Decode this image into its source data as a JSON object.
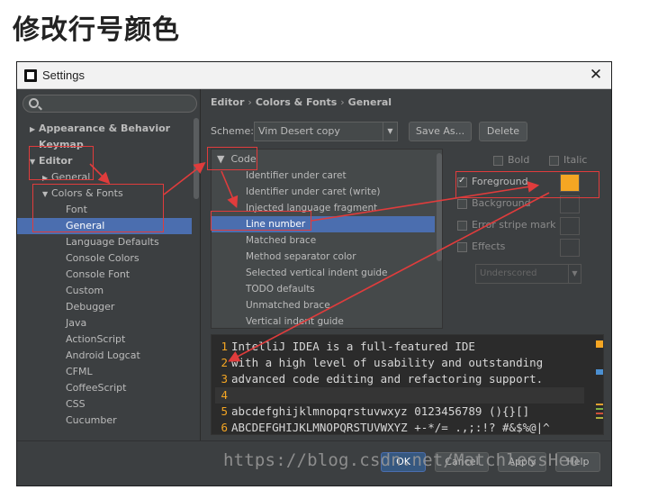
{
  "heading": "修改行号颜色",
  "window": {
    "title": "Settings",
    "close_icon": "close-icon"
  },
  "search": {
    "placeholder": ""
  },
  "tree": {
    "items": [
      {
        "label": "Appearance & Behavior",
        "arrow": "▶"
      },
      {
        "label": "Keymap",
        "arrow": ""
      },
      {
        "label": "Editor",
        "arrow": "▼"
      },
      {
        "label": "General",
        "arrow": "▶"
      },
      {
        "label": "Colors & Fonts",
        "arrow": "▼"
      },
      {
        "label": "Font",
        "arrow": ""
      },
      {
        "label": "General",
        "arrow": ""
      },
      {
        "label": "Language Defaults",
        "arrow": ""
      },
      {
        "label": "Console Colors",
        "arrow": ""
      },
      {
        "label": "Console Font",
        "arrow": ""
      },
      {
        "label": "Custom",
        "arrow": ""
      },
      {
        "label": "Debugger",
        "arrow": ""
      },
      {
        "label": "Java",
        "arrow": ""
      },
      {
        "label": "ActionScript",
        "arrow": ""
      },
      {
        "label": "Android Logcat",
        "arrow": ""
      },
      {
        "label": "CFML",
        "arrow": ""
      },
      {
        "label": "CoffeeScript",
        "arrow": ""
      },
      {
        "label": "CSS",
        "arrow": ""
      },
      {
        "label": "Cucumber",
        "arrow": ""
      }
    ]
  },
  "breadcrumb": {
    "part1": "Editor",
    "part2": "Colors & Fonts",
    "part3": "General",
    "sep": "›"
  },
  "scheme": {
    "label": "Scheme:",
    "value": "Vim Desert copy",
    "save_as": "Save As...",
    "delete": "Delete"
  },
  "elements": {
    "group": "Code",
    "group_arrow": "▼",
    "items": [
      "Identifier under caret",
      "Identifier under caret (write)",
      "Injected language fragment",
      "Line number",
      "Matched brace",
      "Method separator color",
      "Selected vertical indent guide",
      "TODO defaults",
      "Unmatched brace",
      "Vertical indent guide"
    ]
  },
  "attributes": {
    "bold": "Bold",
    "italic": "Italic",
    "foreground": "Foreground",
    "background": "Background",
    "error_stripe": "Error stripe mark",
    "effects": "Effects",
    "effects_type": "Underscored",
    "foreground_color": "#f5a623"
  },
  "preview": {
    "lines": [
      {
        "n": "1",
        "text": "IntelliJ IDEA is a full-featured IDE"
      },
      {
        "n": "2",
        "text": "with a high level of usability and outstanding"
      },
      {
        "n": "3",
        "text": "advanced code editing and refactoring support."
      },
      {
        "n": "4",
        "text": ""
      },
      {
        "n": "5",
        "text": "abcdefghijklmnopqrstuvwxyz 0123456789 (){}[]"
      },
      {
        "n": "6",
        "text": "ABCDEFGHIJKLMNOPQRSTUVWXYZ +-*/= .,;:!? #&$%@|^"
      }
    ]
  },
  "buttons": {
    "ok": "OK",
    "cancel": "Cancel",
    "apply": "Apply",
    "help": "Help"
  },
  "watermark": "https://blog.csdn.net/MatchlessHeo",
  "colors": {
    "annotation": "#e03c3c",
    "selection": "#4b6eaf",
    "line_number": "#f5a623"
  }
}
